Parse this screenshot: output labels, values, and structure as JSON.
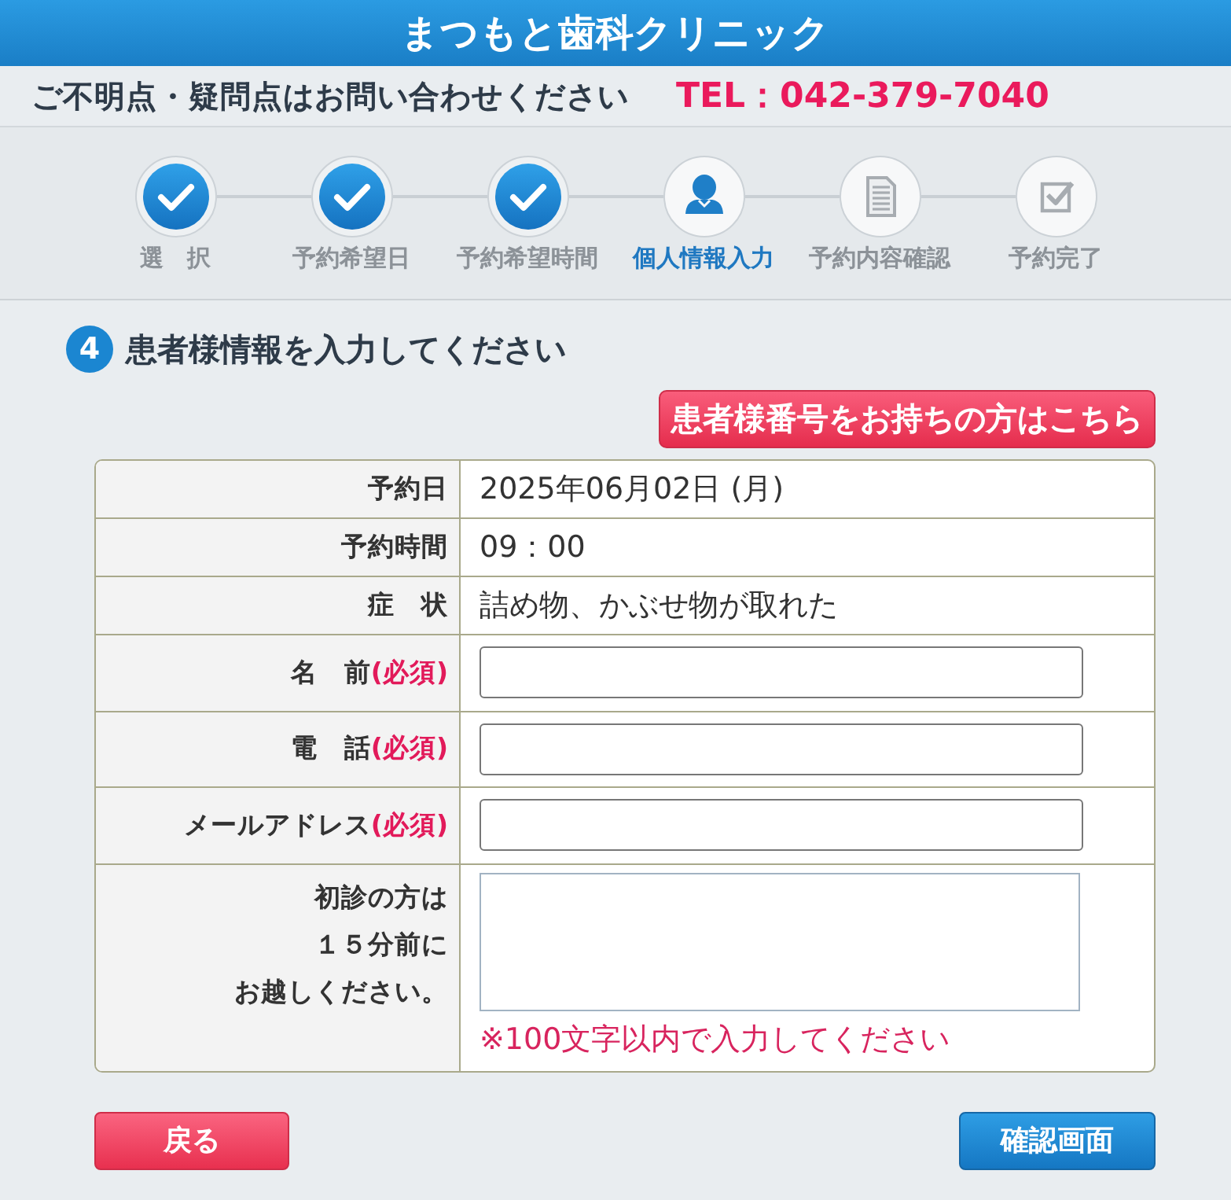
{
  "header": {
    "title": "まつもと歯科クリニック"
  },
  "contact_bar": {
    "message": "ご不明点・疑問点はお問い合わせください",
    "phone": "TEL：042-379-7040"
  },
  "steps": [
    {
      "label": "選　択",
      "completed": true,
      "selected": false
    },
    {
      "label": "予約希望日",
      "completed": true,
      "selected": false
    },
    {
      "label": "予約希望時間",
      "completed": true,
      "selected": false
    },
    {
      "label": "個人情報入力",
      "completed": false,
      "selected": true
    },
    {
      "label": "予約内容確認",
      "completed": false,
      "selected": false
    },
    {
      "label": "予約完了",
      "completed": false,
      "selected": false
    }
  ],
  "section": {
    "number": "4",
    "title": "患者様情報を入力してください"
  },
  "patient_number_button": {
    "label": "患者様番号をお持ちの方はこちら"
  },
  "form_rows": [
    {
      "kind": "text",
      "label": "予約日",
      "value": "2025年06月02日 (月)"
    },
    {
      "kind": "text",
      "label": "予約時間",
      "value": "09：00"
    },
    {
      "kind": "text",
      "label": "症　状",
      "value": "詰め物、かぶせ物が取れた"
    },
    {
      "kind": "input",
      "label": "名　前",
      "required": "(必須)"
    },
    {
      "kind": "input",
      "label": "電　話",
      "required": "(必須)"
    },
    {
      "kind": "input",
      "label": "メールアドレス",
      "required": "(必須)"
    },
    {
      "kind": "textarea",
      "label_lines": [
        "初診の方は",
        "１５分前に",
        "お越しください。"
      ],
      "note": "※100文字以内で入力してください"
    }
  ],
  "buttons": [
    {
      "label": "戻る",
      "kind": "back"
    },
    {
      "label": "確認画面",
      "kind": "submit"
    }
  ]
}
